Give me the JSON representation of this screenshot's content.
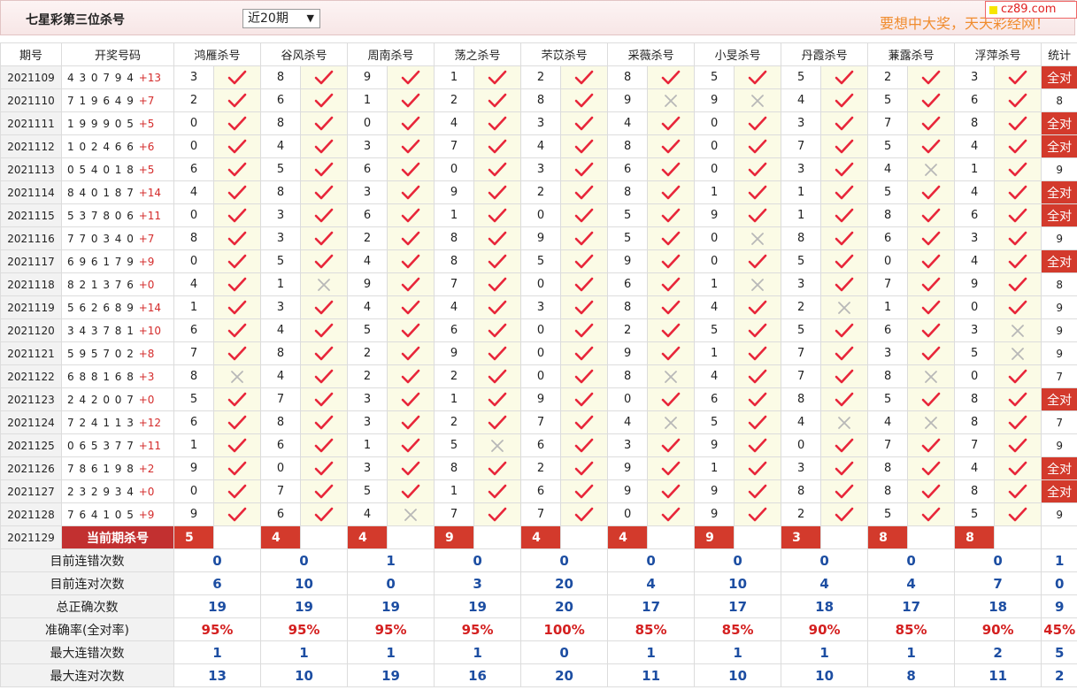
{
  "header": {
    "title": "七星彩第三位杀号",
    "range_select": "近20期",
    "slogan": "要想中大奖，天天彩经网！",
    "brand": "cz89.com"
  },
  "columns": {
    "period": "期号",
    "draw": "开奖号码",
    "experts": [
      "鸿雁杀号",
      "谷风杀号",
      "周南杀号",
      "荡之杀号",
      "芣苡杀号",
      "采薇杀号",
      "小旻杀号",
      "丹霞杀号",
      "蒹露杀号",
      "浮萍杀号"
    ],
    "stat": "统计"
  },
  "rows": [
    {
      "period": "2021109",
      "draw": "4 3 0 7 9 4",
      "sum": "+13",
      "kills": [
        "3",
        "8",
        "9",
        "1",
        "2",
        "8",
        "5",
        "5",
        "2",
        "3"
      ],
      "marks": [
        1,
        1,
        1,
        1,
        1,
        1,
        1,
        1,
        1,
        1
      ],
      "stat": "全对"
    },
    {
      "period": "2021110",
      "draw": "7 1 9 6 4 9",
      "sum": "+7",
      "kills": [
        "2",
        "6",
        "1",
        "2",
        "8",
        "9",
        "9",
        "4",
        "5",
        "6"
      ],
      "marks": [
        1,
        1,
        1,
        1,
        1,
        0,
        0,
        1,
        1,
        1
      ],
      "stat": "8"
    },
    {
      "period": "2021111",
      "draw": "1 9 9 9 0 5",
      "sum": "+5",
      "kills": [
        "0",
        "8",
        "0",
        "4",
        "3",
        "4",
        "0",
        "3",
        "7",
        "8"
      ],
      "marks": [
        1,
        1,
        1,
        1,
        1,
        1,
        1,
        1,
        1,
        1
      ],
      "stat": "全对"
    },
    {
      "period": "2021112",
      "draw": "1 0 2 4 6 6",
      "sum": "+6",
      "kills": [
        "0",
        "4",
        "3",
        "7",
        "4",
        "8",
        "0",
        "7",
        "5",
        "4"
      ],
      "marks": [
        1,
        1,
        1,
        1,
        1,
        1,
        1,
        1,
        1,
        1
      ],
      "stat": "全对"
    },
    {
      "period": "2021113",
      "draw": "0 5 4 0 1 8",
      "sum": "+5",
      "kills": [
        "6",
        "5",
        "6",
        "0",
        "3",
        "6",
        "0",
        "3",
        "4",
        "1"
      ],
      "marks": [
        1,
        1,
        1,
        1,
        1,
        1,
        1,
        1,
        0,
        1
      ],
      "stat": "9"
    },
    {
      "period": "2021114",
      "draw": "8 4 0 1 8 7",
      "sum": "+14",
      "kills": [
        "4",
        "8",
        "3",
        "9",
        "2",
        "8",
        "1",
        "1",
        "5",
        "4"
      ],
      "marks": [
        1,
        1,
        1,
        1,
        1,
        1,
        1,
        1,
        1,
        1
      ],
      "stat": "全对"
    },
    {
      "period": "2021115",
      "draw": "5 3 7 8 0 6",
      "sum": "+11",
      "kills": [
        "0",
        "3",
        "6",
        "1",
        "0",
        "5",
        "9",
        "1",
        "8",
        "6"
      ],
      "marks": [
        1,
        1,
        1,
        1,
        1,
        1,
        1,
        1,
        1,
        1
      ],
      "stat": "全对"
    },
    {
      "period": "2021116",
      "draw": "7 7 0 3 4 0",
      "sum": "+7",
      "kills": [
        "8",
        "3",
        "2",
        "8",
        "9",
        "5",
        "0",
        "8",
        "6",
        "3"
      ],
      "marks": [
        1,
        1,
        1,
        1,
        1,
        1,
        0,
        1,
        1,
        1
      ],
      "stat": "9"
    },
    {
      "period": "2021117",
      "draw": "6 9 6 1 7 9",
      "sum": "+9",
      "kills": [
        "0",
        "5",
        "4",
        "8",
        "5",
        "9",
        "0",
        "5",
        "0",
        "4"
      ],
      "marks": [
        1,
        1,
        1,
        1,
        1,
        1,
        1,
        1,
        1,
        1
      ],
      "stat": "全对"
    },
    {
      "period": "2021118",
      "draw": "8 2 1 3 7 6",
      "sum": "+0",
      "kills": [
        "4",
        "1",
        "9",
        "7",
        "0",
        "6",
        "1",
        "3",
        "7",
        "9"
      ],
      "marks": [
        1,
        0,
        1,
        1,
        1,
        1,
        0,
        1,
        1,
        1
      ],
      "stat": "8"
    },
    {
      "period": "2021119",
      "draw": "5 6 2 6 8 9",
      "sum": "+14",
      "kills": [
        "1",
        "3",
        "4",
        "4",
        "3",
        "8",
        "4",
        "2",
        "1",
        "0"
      ],
      "marks": [
        1,
        1,
        1,
        1,
        1,
        1,
        1,
        0,
        1,
        1
      ],
      "stat": "9"
    },
    {
      "period": "2021120",
      "draw": "3 4 3 7 8 1",
      "sum": "+10",
      "kills": [
        "6",
        "4",
        "5",
        "6",
        "0",
        "2",
        "5",
        "5",
        "6",
        "3"
      ],
      "marks": [
        1,
        1,
        1,
        1,
        1,
        1,
        1,
        1,
        1,
        0
      ],
      "stat": "9"
    },
    {
      "period": "2021121",
      "draw": "5 9 5 7 0 2",
      "sum": "+8",
      "kills": [
        "7",
        "8",
        "2",
        "9",
        "0",
        "9",
        "1",
        "7",
        "3",
        "5"
      ],
      "marks": [
        1,
        1,
        1,
        1,
        1,
        1,
        1,
        1,
        1,
        0
      ],
      "stat": "9"
    },
    {
      "period": "2021122",
      "draw": "6 8 8 1 6 8",
      "sum": "+3",
      "kills": [
        "8",
        "4",
        "2",
        "2",
        "0",
        "8",
        "4",
        "7",
        "8",
        "0"
      ],
      "marks": [
        0,
        1,
        1,
        1,
        1,
        0,
        1,
        1,
        0,
        1
      ],
      "stat": "7"
    },
    {
      "period": "2021123",
      "draw": "2 4 2 0 0 7",
      "sum": "+0",
      "kills": [
        "5",
        "7",
        "3",
        "1",
        "9",
        "0",
        "6",
        "8",
        "5",
        "8"
      ],
      "marks": [
        1,
        1,
        1,
        1,
        1,
        1,
        1,
        1,
        1,
        1
      ],
      "stat": "全对"
    },
    {
      "period": "2021124",
      "draw": "7 2 4 1 1 3",
      "sum": "+12",
      "kills": [
        "6",
        "8",
        "3",
        "2",
        "7",
        "4",
        "5",
        "4",
        "4",
        "8"
      ],
      "marks": [
        1,
        1,
        1,
        1,
        1,
        0,
        1,
        0,
        0,
        1
      ],
      "stat": "7"
    },
    {
      "period": "2021125",
      "draw": "0 6 5 3 7 7",
      "sum": "+11",
      "kills": [
        "1",
        "6",
        "1",
        "5",
        "6",
        "3",
        "9",
        "0",
        "7",
        "7"
      ],
      "marks": [
        1,
        1,
        1,
        0,
        1,
        1,
        1,
        1,
        1,
        1
      ],
      "stat": "9"
    },
    {
      "period": "2021126",
      "draw": "7 8 6 1 9 8",
      "sum": "+2",
      "kills": [
        "9",
        "0",
        "3",
        "8",
        "2",
        "9",
        "1",
        "3",
        "8",
        "4"
      ],
      "marks": [
        1,
        1,
        1,
        1,
        1,
        1,
        1,
        1,
        1,
        1
      ],
      "stat": "全对"
    },
    {
      "period": "2021127",
      "draw": "2 3 2 9 3 4",
      "sum": "+0",
      "kills": [
        "0",
        "7",
        "5",
        "1",
        "6",
        "9",
        "9",
        "8",
        "8",
        "8"
      ],
      "marks": [
        1,
        1,
        1,
        1,
        1,
        1,
        1,
        1,
        1,
        1
      ],
      "stat": "全对"
    },
    {
      "period": "2021128",
      "draw": "7 6 4 1 0 5",
      "sum": "+9",
      "kills": [
        "9",
        "6",
        "4",
        "7",
        "7",
        "0",
        "9",
        "2",
        "5",
        "5"
      ],
      "marks": [
        1,
        1,
        0,
        1,
        1,
        1,
        1,
        1,
        1,
        1
      ],
      "stat": "9"
    }
  ],
  "current": {
    "period": "2021129",
    "label": "当前期杀号",
    "kills": [
      "5",
      "4",
      "4",
      "9",
      "4",
      "4",
      "9",
      "3",
      "8",
      "8"
    ]
  },
  "summary": [
    {
      "label": "目前连错次数",
      "values": [
        "0",
        "0",
        "1",
        "0",
        "0",
        "0",
        "0",
        "0",
        "0",
        "0"
      ],
      "stat": "1"
    },
    {
      "label": "目前连对次数",
      "values": [
        "6",
        "10",
        "0",
        "3",
        "20",
        "4",
        "10",
        "4",
        "4",
        "7"
      ],
      "stat": "0"
    },
    {
      "label": "总正确次数",
      "values": [
        "19",
        "19",
        "19",
        "19",
        "20",
        "17",
        "17",
        "18",
        "17",
        "18"
      ],
      "stat": "9"
    },
    {
      "label": "准确率(全对率)",
      "values": [
        "95%",
        "95%",
        "95%",
        "95%",
        "100%",
        "85%",
        "85%",
        "90%",
        "85%",
        "90%"
      ],
      "stat": "45%",
      "red": true
    },
    {
      "label": "最大连错次数",
      "values": [
        "1",
        "1",
        "1",
        "1",
        "0",
        "1",
        "1",
        "1",
        "1",
        "2"
      ],
      "stat": "5"
    },
    {
      "label": "最大连对次数",
      "values": [
        "13",
        "10",
        "19",
        "16",
        "20",
        "11",
        "10",
        "10",
        "8",
        "11"
      ],
      "stat": "2"
    }
  ],
  "colors": {
    "check": "#e8263a",
    "cross": "#b8b8b8",
    "accent": "#d33a2c",
    "value_blue": "#1d4ea2"
  }
}
